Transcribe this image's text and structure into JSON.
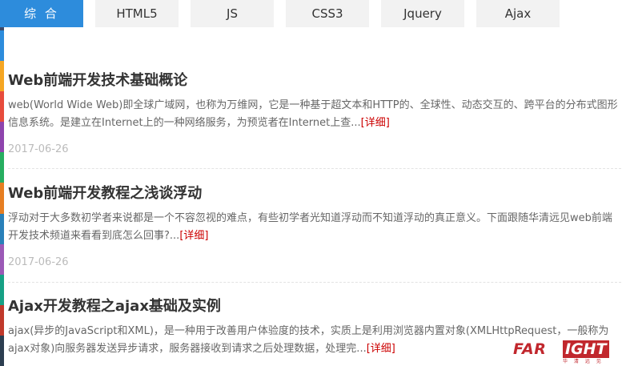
{
  "colors": {
    "accent": "#2d8cdc",
    "tab_bg": "#f2f2f2",
    "link_red": "#cc0000",
    "brand_red": "#c1272d",
    "rail": [
      "#3b4a6b",
      "#2d8cdc",
      "#f5a623",
      "#e74c3c",
      "#8e44ad",
      "#27ae60",
      "#e67e22",
      "#2980b9",
      "#9b59b6",
      "#16a085",
      "#c0392b",
      "#2c3e50"
    ]
  },
  "tabs": [
    {
      "label": "综 合",
      "active": true
    },
    {
      "label": "HTML5",
      "active": false
    },
    {
      "label": "JS",
      "active": false
    },
    {
      "label": "CSS3",
      "active": false
    },
    {
      "label": "Jquery",
      "active": false
    },
    {
      "label": "Ajax",
      "active": false
    }
  ],
  "articles": [
    {
      "title": "Web前端开发技术基础概论",
      "desc": "web(World Wide Web)即全球广域网，也称为万维网，它是一种基于超文本和HTTP的、全球性、动态交互的、跨平台的分布式图形信息系统。是建立在Internet上的一种网络服务，为预览者在Internet上查...",
      "more": "[详细]",
      "date": "2017-06-26"
    },
    {
      "title": "Web前端开发教程之浅谈浮动",
      "desc": "浮动对于大多数初学者来说都是一个不容忽视的难点，有些初学者光知道浮动而不知道浮动的真正意义。下面跟随华清远见web前端开发技术频道来看看到底怎么回事?...",
      "more": "[详细]",
      "date": "2017-06-26"
    },
    {
      "title": "Ajax开发教程之ajax基础及实例",
      "desc": "ajax(异步的JavaScript和XML)，是一种用于改善用户体验度的技术，实质上是利用浏览器内置对象(XMLHttpRequest，一般称为ajax对象)向服务器发送异步请求，服务器接收到请求之后处理数据，处理完...",
      "more": "[详细]",
      "date": ""
    }
  ],
  "watermark": {
    "brand_a": "FAR",
    "brand_b": "IGHT",
    "tagline": "华 清 远 见"
  }
}
